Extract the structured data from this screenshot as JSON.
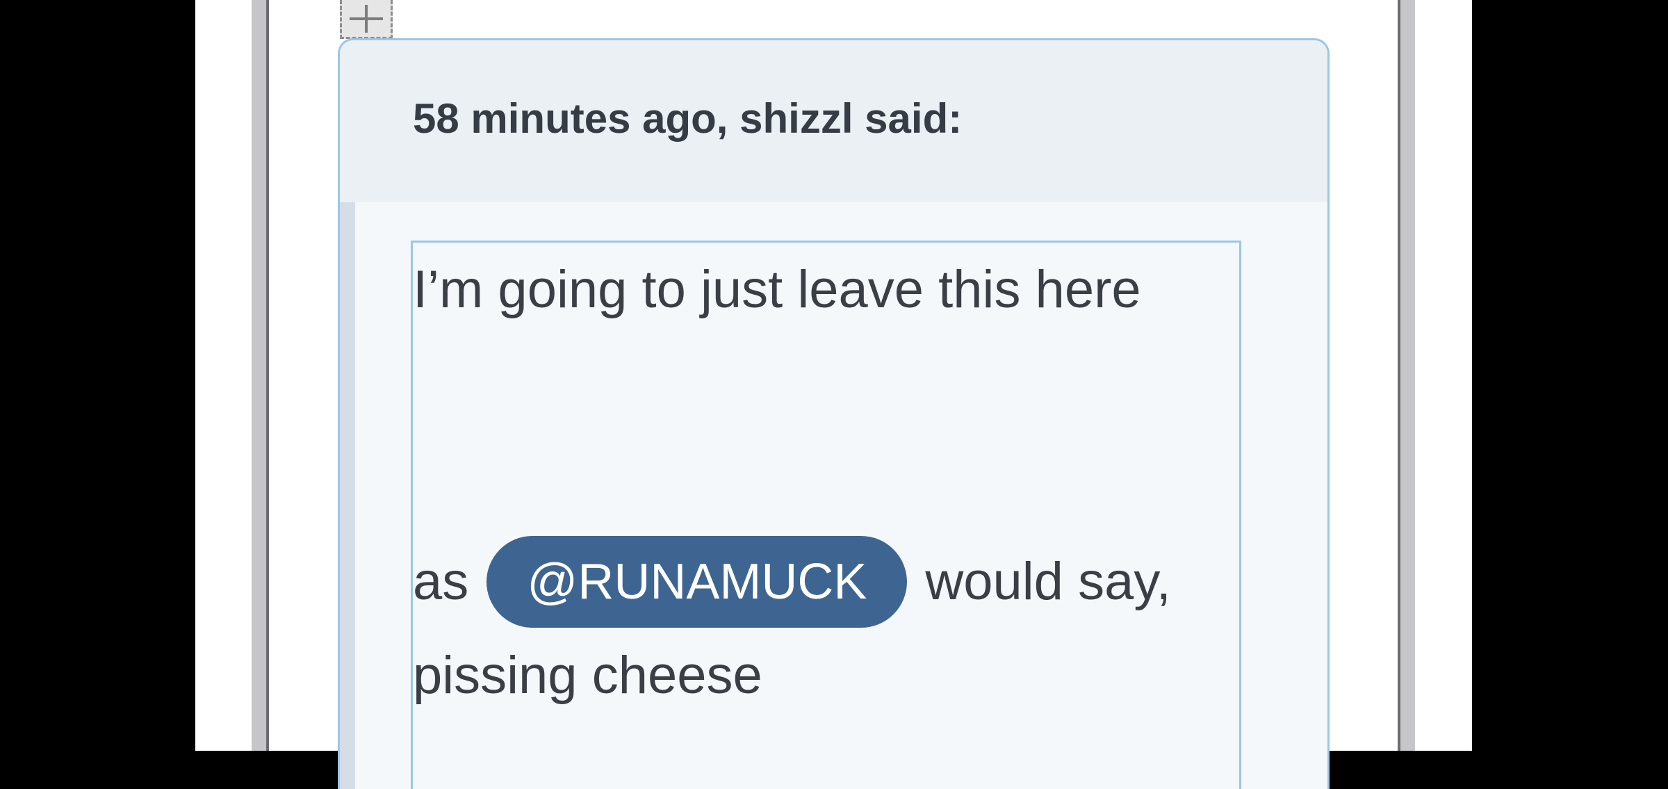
{
  "quote": {
    "citation": "58 minutes ago, shizzl said:",
    "line1": "I’m going to just leave this here",
    "line2_prefix": "as",
    "mention": "@RUNAMUCK",
    "line2_suffix": "would say,",
    "line3": "pissing cheese"
  },
  "icons": {
    "move_handle": "move-arrows-icon"
  },
  "colors": {
    "mention_bg": "#3e6592",
    "quote_border": "#9cc6e6",
    "quote_header_bg": "#ebf0f4",
    "quote_body_bg": "#f4f8fb"
  }
}
